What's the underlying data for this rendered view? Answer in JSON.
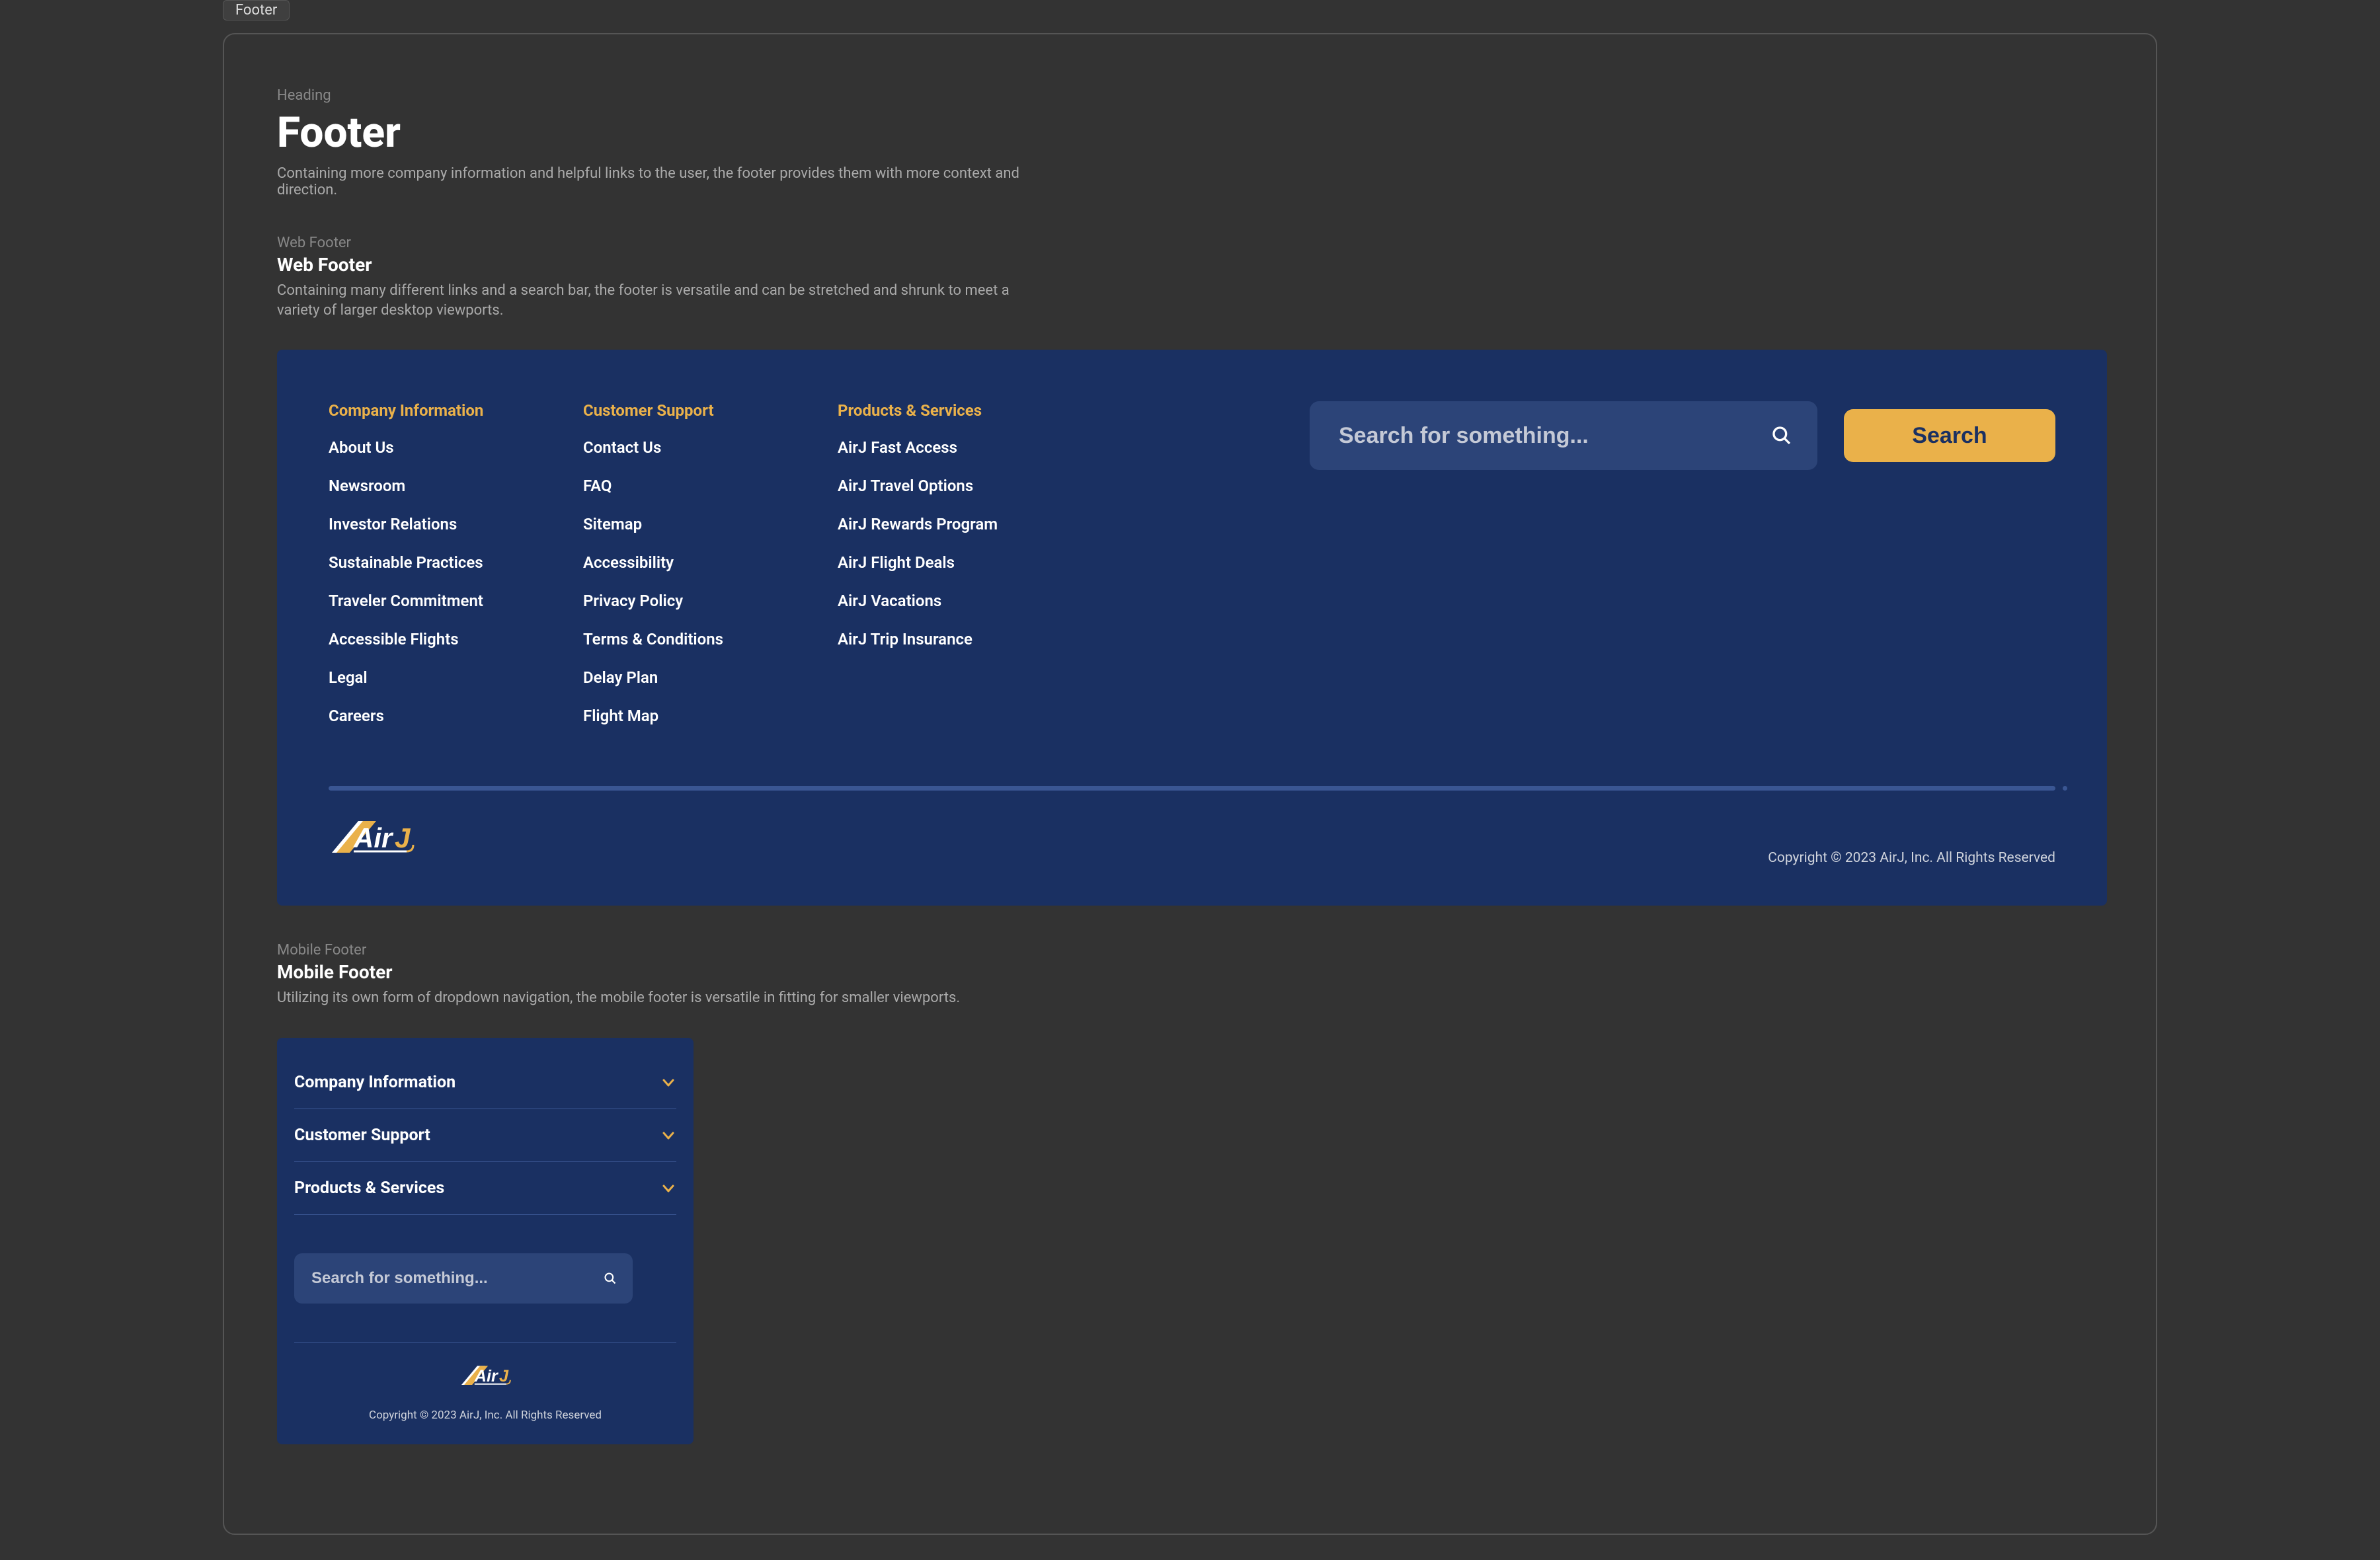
{
  "colors": {
    "brand_orange": "#eab14a",
    "brand_navy": "#1a3062",
    "brand_navy_light": "#2c4478"
  },
  "tab": {
    "label": "Footer"
  },
  "heading": {
    "overline": "Heading",
    "title": "Footer",
    "description": "Containing more company information and helpful links to the user, the footer provides them with more context and direction."
  },
  "web_footer_intro": {
    "overline": "Web Footer",
    "title": "Web Footer",
    "description": "Containing many different links and a search bar, the footer is versatile and can be stretched and shrunk to meet a variety of larger desktop viewports."
  },
  "web_footer": {
    "columns": [
      {
        "title": "Company Information",
        "links": [
          "About Us",
          "Newsroom",
          "Investor Relations",
          "Sustainable Practices",
          "Traveler Commitment",
          "Accessible Flights",
          "Legal",
          "Careers"
        ]
      },
      {
        "title": "Customer Support",
        "links": [
          "Contact Us",
          "FAQ",
          "Sitemap",
          "Accessibility",
          "Privacy Policy",
          "Terms & Conditions",
          "Delay Plan",
          "Flight Map"
        ]
      },
      {
        "title": "Products & Services",
        "links": [
          "AirJ Fast Access",
          "AirJ Travel Options",
          "AirJ Rewards Program",
          "AirJ Flight Deals",
          "AirJ Vacations",
          "AirJ Trip Insurance"
        ]
      }
    ],
    "search": {
      "placeholder": "Search for something...",
      "button_label": "Search"
    },
    "copyright": "Copyright © 2023 AirJ, Inc. All Rights Reserved"
  },
  "mobile_footer_intro": {
    "overline": "Mobile Footer",
    "title": "Mobile Footer",
    "description": "Utilizing its own form of dropdown navigation, the mobile footer is versatile in fitting for smaller viewports."
  },
  "mobile_footer": {
    "sections": [
      "Company Information",
      "Customer Support",
      "Products & Services"
    ],
    "search": {
      "placeholder": "Search for something..."
    },
    "copyright": "Copyright © 2023 AirJ, Inc. All Rights Reserved"
  },
  "brand": {
    "name": "AirJ"
  }
}
